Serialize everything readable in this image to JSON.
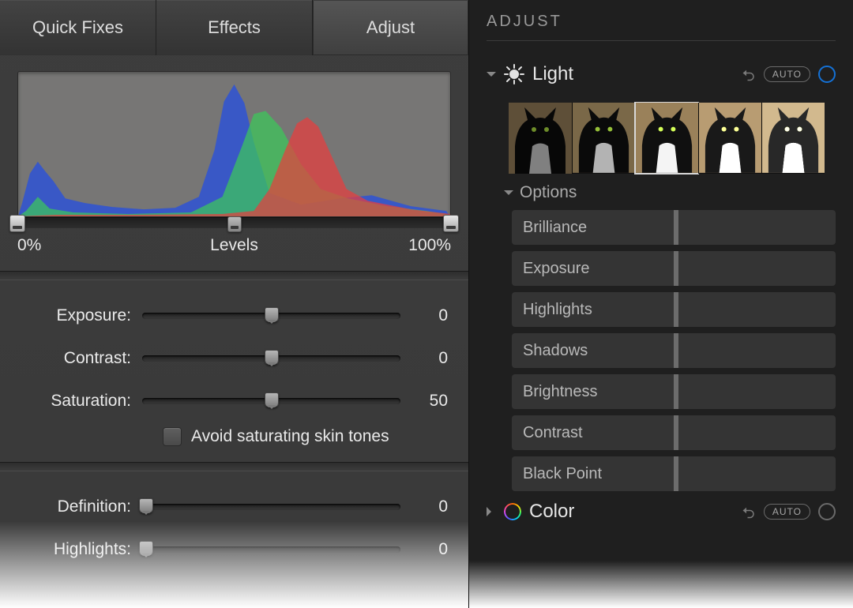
{
  "left": {
    "tabs": [
      "Quick Fixes",
      "Effects",
      "Adjust"
    ],
    "active_tab": 2,
    "levels": {
      "label": "Levels",
      "min_label": "0%",
      "max_label": "100%"
    },
    "sliders": [
      {
        "label": "Exposure:",
        "value": "0",
        "pos": 50
      },
      {
        "label": "Contrast:",
        "value": "0",
        "pos": 50
      },
      {
        "label": "Saturation:",
        "value": "50",
        "pos": 50
      }
    ],
    "skin_checkbox": {
      "label": "Avoid saturating skin tones",
      "checked": false
    },
    "sliders2": [
      {
        "label": "Definition:",
        "value": "0",
        "pos": 0
      },
      {
        "label": "Highlights:",
        "value": "0",
        "pos": 0
      }
    ]
  },
  "right": {
    "title": "ADJUST",
    "light": {
      "name": "Light",
      "auto_label": "AUTO",
      "options_label": "Options",
      "options": [
        "Brilliance",
        "Exposure",
        "Highlights",
        "Shadows",
        "Brightness",
        "Contrast",
        "Black Point"
      ]
    },
    "color": {
      "name": "Color",
      "auto_label": "AUTO"
    }
  }
}
